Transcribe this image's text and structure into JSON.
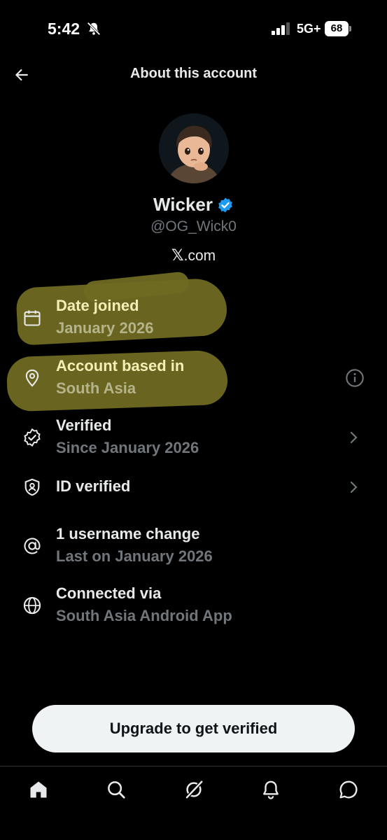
{
  "status_bar": {
    "time": "5:42",
    "network": "5G+",
    "battery": "68"
  },
  "header": {
    "title": "About this account",
    "back_icon": "arrow-left-icon"
  },
  "profile": {
    "display_name": "Wicker",
    "handle": "@OG_Wick0",
    "site_glyph": "𝕏",
    "site_text": ".com",
    "badge_color": "#1d9bf0"
  },
  "info_rows": [
    {
      "title": "Date joined",
      "subtitle": "January 2026",
      "icon": "calendar-icon"
    },
    {
      "title": "Account based in",
      "subtitle": "South Asia",
      "icon": "location-pin-icon",
      "trailing": "info-icon"
    },
    {
      "title": "Verified",
      "subtitle": "Since January 2026",
      "icon": "verified-check-icon",
      "trailing": "chevron-right-icon"
    },
    {
      "title": "ID verified",
      "subtitle": "",
      "icon": "id-shield-icon",
      "trailing": "chevron-right-icon"
    },
    {
      "title": "1 username change",
      "subtitle": "Last on January 2026",
      "icon": "at-sign-icon"
    },
    {
      "title": "Connected via",
      "subtitle": "South Asia Android App",
      "icon": "globe-icon"
    }
  ],
  "cta": {
    "label": "Upgrade to get verified"
  },
  "bottom_nav": [
    "home-icon",
    "search-icon",
    "grok-icon",
    "notifications-icon",
    "messages-icon"
  ],
  "colors": {
    "background": "#000000",
    "text_primary": "#e7e9ea",
    "text_secondary": "#71767b",
    "highlight": "#6f6a22",
    "accent": "#1d9bf0"
  }
}
